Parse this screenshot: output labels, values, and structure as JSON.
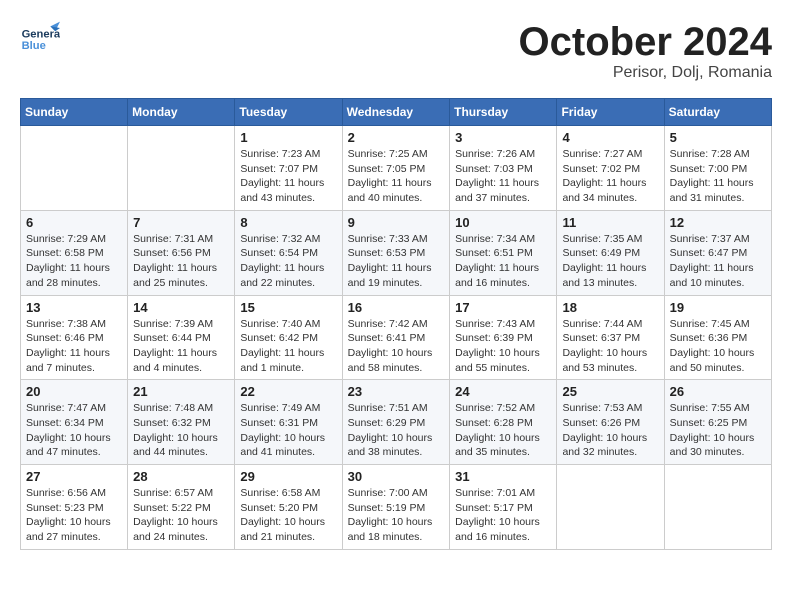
{
  "header": {
    "logo": {
      "general": "General",
      "blue": "Blue"
    },
    "title": "October 2024",
    "location": "Perisor, Dolj, Romania"
  },
  "weekdays": [
    "Sunday",
    "Monday",
    "Tuesday",
    "Wednesday",
    "Thursday",
    "Friday",
    "Saturday"
  ],
  "weeks": [
    [
      {
        "day": null,
        "sunrise": null,
        "sunset": null,
        "daylight": null
      },
      {
        "day": null,
        "sunrise": null,
        "sunset": null,
        "daylight": null
      },
      {
        "day": "1",
        "sunrise": "Sunrise: 7:23 AM",
        "sunset": "Sunset: 7:07 PM",
        "daylight": "Daylight: 11 hours and 43 minutes."
      },
      {
        "day": "2",
        "sunrise": "Sunrise: 7:25 AM",
        "sunset": "Sunset: 7:05 PM",
        "daylight": "Daylight: 11 hours and 40 minutes."
      },
      {
        "day": "3",
        "sunrise": "Sunrise: 7:26 AM",
        "sunset": "Sunset: 7:03 PM",
        "daylight": "Daylight: 11 hours and 37 minutes."
      },
      {
        "day": "4",
        "sunrise": "Sunrise: 7:27 AM",
        "sunset": "Sunset: 7:02 PM",
        "daylight": "Daylight: 11 hours and 34 minutes."
      },
      {
        "day": "5",
        "sunrise": "Sunrise: 7:28 AM",
        "sunset": "Sunset: 7:00 PM",
        "daylight": "Daylight: 11 hours and 31 minutes."
      }
    ],
    [
      {
        "day": "6",
        "sunrise": "Sunrise: 7:29 AM",
        "sunset": "Sunset: 6:58 PM",
        "daylight": "Daylight: 11 hours and 28 minutes."
      },
      {
        "day": "7",
        "sunrise": "Sunrise: 7:31 AM",
        "sunset": "Sunset: 6:56 PM",
        "daylight": "Daylight: 11 hours and 25 minutes."
      },
      {
        "day": "8",
        "sunrise": "Sunrise: 7:32 AM",
        "sunset": "Sunset: 6:54 PM",
        "daylight": "Daylight: 11 hours and 22 minutes."
      },
      {
        "day": "9",
        "sunrise": "Sunrise: 7:33 AM",
        "sunset": "Sunset: 6:53 PM",
        "daylight": "Daylight: 11 hours and 19 minutes."
      },
      {
        "day": "10",
        "sunrise": "Sunrise: 7:34 AM",
        "sunset": "Sunset: 6:51 PM",
        "daylight": "Daylight: 11 hours and 16 minutes."
      },
      {
        "day": "11",
        "sunrise": "Sunrise: 7:35 AM",
        "sunset": "Sunset: 6:49 PM",
        "daylight": "Daylight: 11 hours and 13 minutes."
      },
      {
        "day": "12",
        "sunrise": "Sunrise: 7:37 AM",
        "sunset": "Sunset: 6:47 PM",
        "daylight": "Daylight: 11 hours and 10 minutes."
      }
    ],
    [
      {
        "day": "13",
        "sunrise": "Sunrise: 7:38 AM",
        "sunset": "Sunset: 6:46 PM",
        "daylight": "Daylight: 11 hours and 7 minutes."
      },
      {
        "day": "14",
        "sunrise": "Sunrise: 7:39 AM",
        "sunset": "Sunset: 6:44 PM",
        "daylight": "Daylight: 11 hours and 4 minutes."
      },
      {
        "day": "15",
        "sunrise": "Sunrise: 7:40 AM",
        "sunset": "Sunset: 6:42 PM",
        "daylight": "Daylight: 11 hours and 1 minute."
      },
      {
        "day": "16",
        "sunrise": "Sunrise: 7:42 AM",
        "sunset": "Sunset: 6:41 PM",
        "daylight": "Daylight: 10 hours and 58 minutes."
      },
      {
        "day": "17",
        "sunrise": "Sunrise: 7:43 AM",
        "sunset": "Sunset: 6:39 PM",
        "daylight": "Daylight: 10 hours and 55 minutes."
      },
      {
        "day": "18",
        "sunrise": "Sunrise: 7:44 AM",
        "sunset": "Sunset: 6:37 PM",
        "daylight": "Daylight: 10 hours and 53 minutes."
      },
      {
        "day": "19",
        "sunrise": "Sunrise: 7:45 AM",
        "sunset": "Sunset: 6:36 PM",
        "daylight": "Daylight: 10 hours and 50 minutes."
      }
    ],
    [
      {
        "day": "20",
        "sunrise": "Sunrise: 7:47 AM",
        "sunset": "Sunset: 6:34 PM",
        "daylight": "Daylight: 10 hours and 47 minutes."
      },
      {
        "day": "21",
        "sunrise": "Sunrise: 7:48 AM",
        "sunset": "Sunset: 6:32 PM",
        "daylight": "Daylight: 10 hours and 44 minutes."
      },
      {
        "day": "22",
        "sunrise": "Sunrise: 7:49 AM",
        "sunset": "Sunset: 6:31 PM",
        "daylight": "Daylight: 10 hours and 41 minutes."
      },
      {
        "day": "23",
        "sunrise": "Sunrise: 7:51 AM",
        "sunset": "Sunset: 6:29 PM",
        "daylight": "Daylight: 10 hours and 38 minutes."
      },
      {
        "day": "24",
        "sunrise": "Sunrise: 7:52 AM",
        "sunset": "Sunset: 6:28 PM",
        "daylight": "Daylight: 10 hours and 35 minutes."
      },
      {
        "day": "25",
        "sunrise": "Sunrise: 7:53 AM",
        "sunset": "Sunset: 6:26 PM",
        "daylight": "Daylight: 10 hours and 32 minutes."
      },
      {
        "day": "26",
        "sunrise": "Sunrise: 7:55 AM",
        "sunset": "Sunset: 6:25 PM",
        "daylight": "Daylight: 10 hours and 30 minutes."
      }
    ],
    [
      {
        "day": "27",
        "sunrise": "Sunrise: 6:56 AM",
        "sunset": "Sunset: 5:23 PM",
        "daylight": "Daylight: 10 hours and 27 minutes."
      },
      {
        "day": "28",
        "sunrise": "Sunrise: 6:57 AM",
        "sunset": "Sunset: 5:22 PM",
        "daylight": "Daylight: 10 hours and 24 minutes."
      },
      {
        "day": "29",
        "sunrise": "Sunrise: 6:58 AM",
        "sunset": "Sunset: 5:20 PM",
        "daylight": "Daylight: 10 hours and 21 minutes."
      },
      {
        "day": "30",
        "sunrise": "Sunrise: 7:00 AM",
        "sunset": "Sunset: 5:19 PM",
        "daylight": "Daylight: 10 hours and 18 minutes."
      },
      {
        "day": "31",
        "sunrise": "Sunrise: 7:01 AM",
        "sunset": "Sunset: 5:17 PM",
        "daylight": "Daylight: 10 hours and 16 minutes."
      },
      {
        "day": null,
        "sunrise": null,
        "sunset": null,
        "daylight": null
      },
      {
        "day": null,
        "sunrise": null,
        "sunset": null,
        "daylight": null
      }
    ]
  ]
}
